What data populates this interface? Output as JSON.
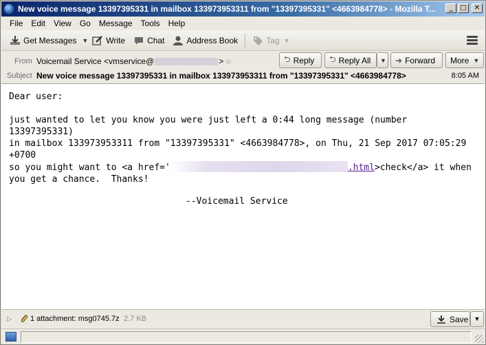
{
  "window": {
    "title": "New voice message 13397395331 in mailbox 133973953311 from \"13397395331\" <4663984778> - Mozilla T...",
    "buttons": {
      "minimize": "_",
      "maximize": "□",
      "close": "✕"
    }
  },
  "menu": [
    "File",
    "Edit",
    "View",
    "Go",
    "Message",
    "Tools",
    "Help"
  ],
  "toolbar": {
    "get_messages": "Get Messages",
    "write": "Write",
    "chat": "Chat",
    "address_book": "Address Book",
    "tag": "Tag"
  },
  "header": {
    "from_label": "From",
    "from_value_start": "Voicemail Service <vmservice@",
    "from_value_end": ">",
    "subject_label": "Subject",
    "subject_value": "New voice message 13397395331 in mailbox 133973953311 from \"13397395331\" <4663984778>",
    "time": "8:05 AM",
    "reply_label": "Reply",
    "reply_all_label": "Reply All",
    "forward_label": "Forward",
    "more_label": "More"
  },
  "body": {
    "greeting": "Dear user:",
    "line1": "just wanted to let you know you were just left a 0:44 long message (number",
    "line2": "13397395331)",
    "line3": "in mailbox 133973953311 from \"13397395331\" <4663984778>, on Thu, 21 Sep 2017 07:05:29",
    "line4": "+0700",
    "line5_start": "so you might want to <a href='",
    "line5_link_end": ".html",
    "line5_end": ">check</a> it when",
    "line6": "you get a chance.  Thanks!",
    "signature": "--Voicemail Service"
  },
  "attachments": {
    "summary": "1 attachment: msg0745.7z",
    "size": "2.7 KB",
    "save_label": "Save"
  }
}
